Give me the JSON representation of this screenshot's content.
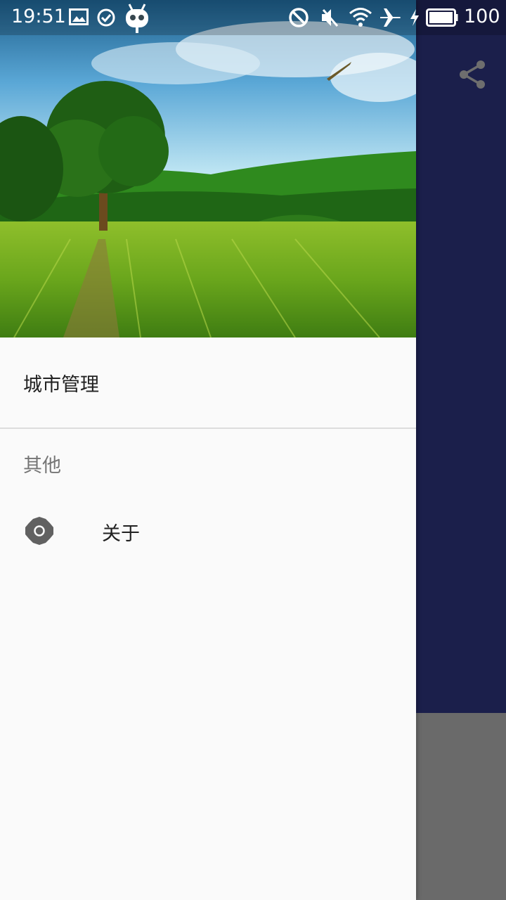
{
  "status_bar": {
    "time": "19:51",
    "battery": "100",
    "icons": [
      "image-icon",
      "check-circle-icon",
      "cyanogen-mascot-icon",
      "do-not-disturb-icon",
      "mute-icon",
      "wifi-icon",
      "airplane-icon",
      "charging-icon",
      "battery-icon"
    ]
  },
  "drawer": {
    "header_image": "landscape-image",
    "items": [
      {
        "label": "城市管理"
      }
    ],
    "sections": [
      {
        "title": "其他",
        "items": [
          {
            "label": "关于",
            "icon": "gear-icon"
          }
        ]
      }
    ]
  },
  "app_bar": {
    "share_icon": "share-icon"
  },
  "colors": {
    "primary": "#1b1f4b",
    "drawer_bg": "#fafafa",
    "scrim_bottom": "#6a6a6a"
  }
}
